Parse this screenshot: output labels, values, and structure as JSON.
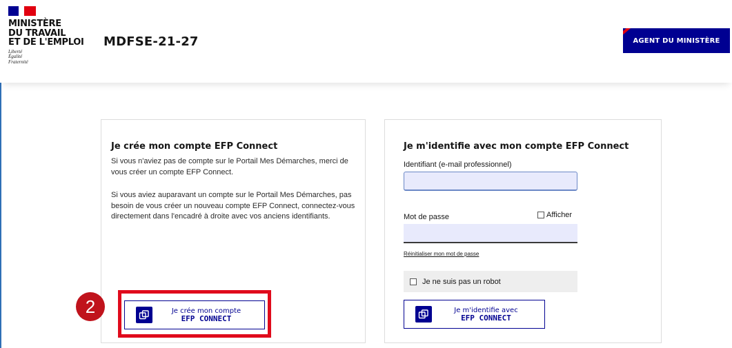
{
  "header": {
    "ministry_line1": "MINISTÈRE",
    "ministry_line2": "DU TRAVAIL",
    "ministry_line3": "ET DE L'EMPLOI",
    "motto1": "Liberté",
    "motto2": "Égalité",
    "motto3": "Fraternité",
    "app_title": "MDFSE-21-27",
    "agent_button": "AGENT DU MINISTÈRE"
  },
  "create_card": {
    "title": "Je crée mon compte EFP Connect",
    "para1": "Si vous n'aviez pas de compte sur le Portail Mes Démarches, merci de vous créer un compte EFP Connect.",
    "para2": "Si vous aviez auparavant un compte sur le Portail Mes Démarches, pas besoin de vous créer un nouveau compte EFP Connect, connectez-vous directement dans l'encadré à droite avec vos anciens identifiants.",
    "button_line1": "Je crée mon compte",
    "button_line2": "EFP CONNECT"
  },
  "login_card": {
    "title": "Je m'identifie avec mon compte EFP Connect",
    "identifier_label": "Identifiant (e-mail professionnel)",
    "identifier_value": "",
    "password_label": "Mot de passe",
    "password_value": "",
    "show_password_label": "Afficher",
    "reset_link": "Réinitialiser mon mot de passe",
    "captcha_label": "Je ne suis pas un robot",
    "button_line1": "Je m'identifie avec",
    "button_line2": "EFP CONNECT"
  },
  "annotation": {
    "step_number": "2",
    "highlight_color": "#e00b1c"
  },
  "colors": {
    "primary": "#000091",
    "flag_red": "#e1000f",
    "input_bg": "#e8eafc"
  }
}
